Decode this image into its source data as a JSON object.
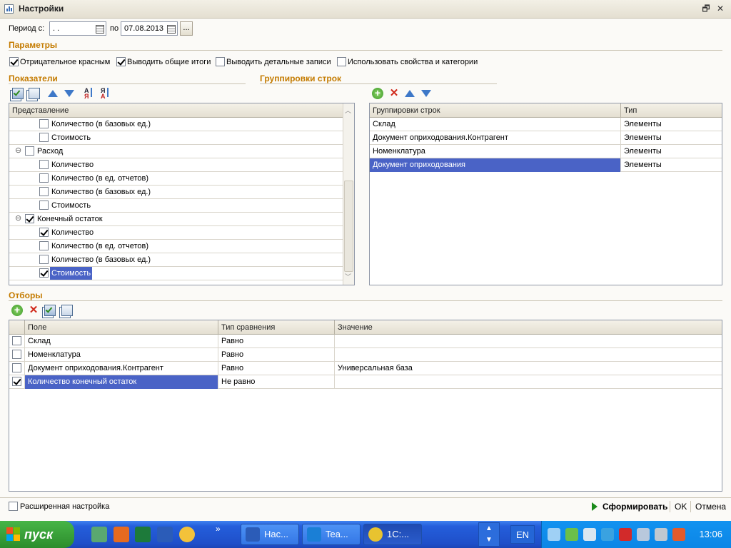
{
  "window": {
    "title": "Настройки",
    "restore_glyph": "🗗",
    "close_glyph": "✕"
  },
  "period": {
    "label_from": "Период с:",
    "from_value": " .  .",
    "label_to": "по",
    "to_value": "07.08.2013",
    "more_label": "..."
  },
  "params": {
    "title": "Параметры",
    "options": [
      {
        "label": "Отрицательное красным",
        "checked": true
      },
      {
        "label": "Выводить общие итоги",
        "checked": true
      },
      {
        "label": "Выводить детальные записи",
        "checked": false
      },
      {
        "label": "Использовать свойства и категории",
        "checked": false
      }
    ]
  },
  "indicators": {
    "title": "Показатели",
    "header": "Представление",
    "icons": [
      "check-all-icon",
      "uncheck-all-icon",
      "move-up-icon",
      "move-down-icon",
      "sort-asc-icon",
      "sort-desc-icon"
    ],
    "rows": [
      {
        "label": "Количество (в базовых ед.)",
        "checked": false,
        "level": 2
      },
      {
        "label": "Стоимость",
        "checked": false,
        "level": 2
      },
      {
        "label": "Расход",
        "checked": false,
        "level": 1,
        "expander": "⊖"
      },
      {
        "label": "Количество",
        "checked": false,
        "level": 2
      },
      {
        "label": "Количество (в ед. отчетов)",
        "checked": false,
        "level": 2
      },
      {
        "label": "Количество (в базовых ед.)",
        "checked": false,
        "level": 2
      },
      {
        "label": "Стоимость",
        "checked": false,
        "level": 2
      },
      {
        "label": "Конечный остаток",
        "checked": true,
        "level": 1,
        "expander": "⊖"
      },
      {
        "label": "Количество",
        "checked": true,
        "level": 2
      },
      {
        "label": "Количество (в ед. отчетов)",
        "checked": false,
        "level": 2
      },
      {
        "label": "Количество (в базовых ед.)",
        "checked": false,
        "level": 2
      },
      {
        "label": "Стоимость",
        "checked": true,
        "level": 2,
        "selected": true
      }
    ]
  },
  "groupings": {
    "title": "Группировки строк",
    "icons": [
      "add-icon",
      "delete-icon",
      "move-up-icon",
      "move-down-icon"
    ],
    "columns": [
      "Группировки строк",
      "Тип"
    ],
    "rows": [
      {
        "field": "Склад",
        "type": "Элементы"
      },
      {
        "field": "Документ оприходования.Контрагент",
        "type": "Элементы"
      },
      {
        "field": "Номенклатура",
        "type": "Элементы"
      },
      {
        "field": "Документ оприходования",
        "type": "Элементы",
        "selected": true
      }
    ]
  },
  "filters": {
    "title": "Отборы",
    "icons": [
      "add-icon",
      "delete-icon",
      "check-all-icon",
      "uncheck-all-icon"
    ],
    "columns": [
      "Поле",
      "Тип сравнения",
      "Значение"
    ],
    "rows": [
      {
        "checked": false,
        "field": "Склад",
        "comparison": "Равно",
        "value": ""
      },
      {
        "checked": false,
        "field": "Номенклатура",
        "comparison": "Равно",
        "value": ""
      },
      {
        "checked": false,
        "field": "Документ оприходования.Контрагент",
        "comparison": "Равно",
        "value": "Универсальная база"
      },
      {
        "checked": true,
        "field": "Количество конечный остаток",
        "comparison": "Не равно",
        "value": "",
        "selected": true
      }
    ]
  },
  "footer": {
    "advanced_label": "Расширенная настройка",
    "advanced_checked": false,
    "generate_label": "Сформировать",
    "ok_label": "OK",
    "cancel_label": "Отмена"
  },
  "taskbar": {
    "start_label": "пуск",
    "quick_launch": [
      "recycle-icon",
      "firefox-icon",
      "excel-icon",
      "word-icon",
      "sun-icon"
    ],
    "chevron": "»",
    "tasks": [
      {
        "label": "Нас...",
        "icon": "word-icon"
      },
      {
        "label": "Tea...",
        "icon": "teamviewer-icon"
      },
      {
        "label": "1С:...",
        "icon": "1c-icon",
        "active": true
      }
    ],
    "updown_up": "▲",
    "updown_down": "▼",
    "language": "EN",
    "tray_icons": [
      "network-icon",
      "tray-app-icon",
      "usb-icon",
      "pen-icon",
      "antivirus-icon",
      "monitors-icon",
      "volume-icon",
      "printer-icon"
    ],
    "clock": "13:06"
  },
  "colors": {
    "accent": "#4a63c6",
    "section": "#c47b00",
    "taskbar": "#245edb",
    "start": "#3a9f3a"
  }
}
